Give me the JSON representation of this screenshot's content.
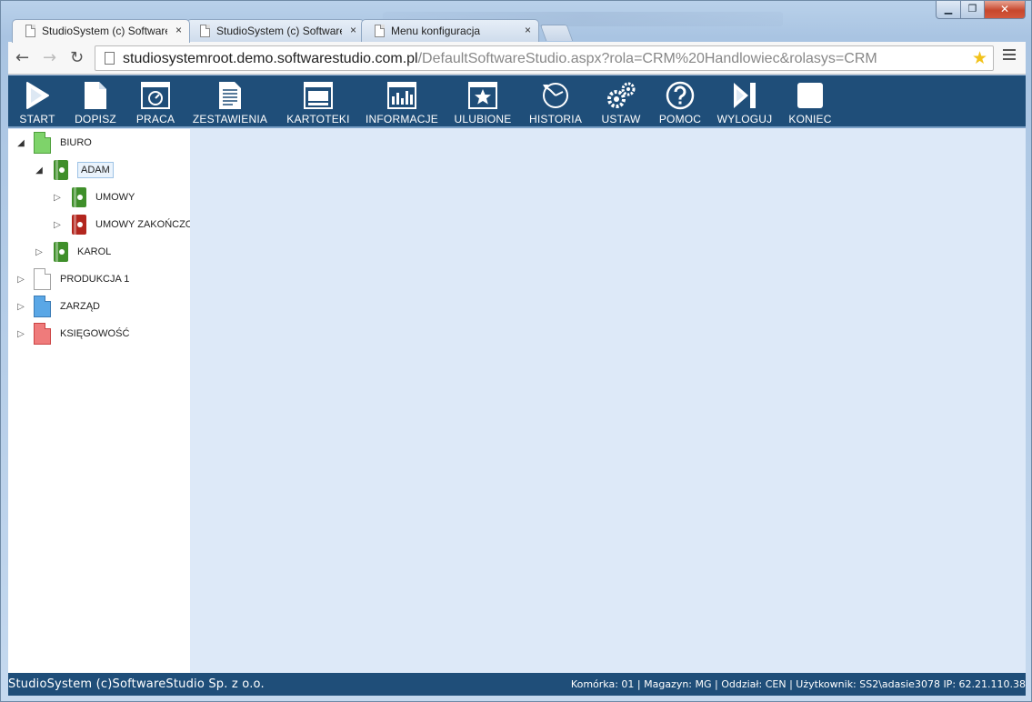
{
  "browser": {
    "tabs": [
      {
        "title": "StudioSystem (c) Software",
        "active": true
      },
      {
        "title": "StudioSystem (c) Software",
        "active": false
      },
      {
        "title": "Menu konfiguracja",
        "active": false
      }
    ],
    "close_glyph": "×",
    "url_host": "studiosystemroot.demo.softwarestudio.com.pl",
    "url_path": "/DefaultSoftwareStudio.aspx?rola=CRM%20Handlowiec&rolasys=CRM"
  },
  "toolbar": {
    "items": [
      {
        "label": "START",
        "icon": "play-icon"
      },
      {
        "label": "DOPISZ",
        "icon": "new-document-icon"
      },
      {
        "label": "PRACA",
        "icon": "work-window-icon"
      },
      {
        "label": "ZESTAWIENIA",
        "icon": "report-document-icon"
      },
      {
        "label": "KARTOTEKI",
        "icon": "card-index-icon"
      },
      {
        "label": "INFORMACJE",
        "icon": "bar-chart-icon"
      },
      {
        "label": "ULUBIONE",
        "icon": "star-window-icon"
      },
      {
        "label": "HISTORIA",
        "icon": "history-icon"
      },
      {
        "label": "USTAW",
        "icon": "gears-icon"
      },
      {
        "label": "POMOC",
        "icon": "help-icon"
      },
      {
        "label": "WYLOGUJ",
        "icon": "logout-icon"
      },
      {
        "label": "KONIEC",
        "icon": "stop-icon"
      }
    ]
  },
  "tree": {
    "nodes": [
      {
        "label": "BIURO",
        "icon": "green-document-icon",
        "expanded": true
      },
      {
        "label": "ADAM",
        "icon": "green-binder-icon",
        "expanded": true,
        "selected": true
      },
      {
        "label": "UMOWY",
        "icon": "green-binder-icon",
        "expanded": false
      },
      {
        "label": "UMOWY ZAKOŃCZONE",
        "icon": "red-binder-icon",
        "expanded": false
      },
      {
        "label": "KAROL",
        "icon": "green-binder-icon",
        "expanded": false
      },
      {
        "label": "PRODUKCJA 1",
        "icon": "white-document-icon",
        "expanded": false
      },
      {
        "label": "ZARZĄD",
        "icon": "blue-document-icon",
        "expanded": false
      },
      {
        "label": "KSIĘGOWOŚĆ",
        "icon": "red-document-icon",
        "expanded": false
      }
    ]
  },
  "status": {
    "left": "StudioSystem (c)SoftwareStudio Sp. z o.o.",
    "right": "Komórka: 01 | Magazyn: MG | Oddział: CEN | Użytkownik: SS2\\adasie3078 IP: 62.21.110.38"
  },
  "colors": {
    "toolbar_bg": "#1f4e79",
    "content_bg": "#dde9f8",
    "green_doc": "#7ed36a",
    "green_binder": "#3f8f2a",
    "red_binder": "#b3261e",
    "blue_doc": "#5aa7e6",
    "red_doc": "#ef7b7b"
  }
}
